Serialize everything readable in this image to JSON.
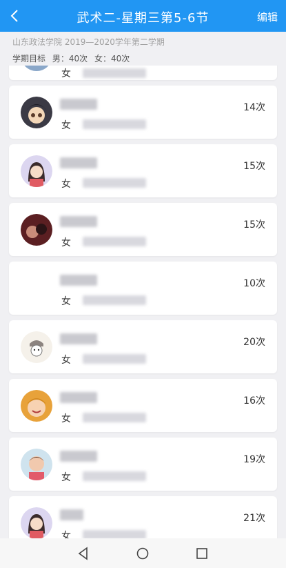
{
  "header": {
    "title": "武术二-星期三第5-6节",
    "edit_label": "编辑"
  },
  "subtitle": "山东政法学院 2019—2020学年第二学期",
  "targets": {
    "label": "学期目标",
    "male": "男：40次",
    "female": "女：40次"
  },
  "partial_item": {
    "gender": "女"
  },
  "students": [
    {
      "gender": "女",
      "count": "14次",
      "avatar": "anime-boy-avatar-icon"
    },
    {
      "gender": "女",
      "count": "15次",
      "avatar": "girl-cartoon-avatar-icon"
    },
    {
      "gender": "女",
      "count": "15次",
      "avatar": "dark-photo-avatar-icon"
    },
    {
      "gender": "女",
      "count": "10次",
      "avatar": "blank-avatar-icon"
    },
    {
      "gender": "女",
      "count": "20次",
      "avatar": "sketch-character-avatar-icon"
    },
    {
      "gender": "女",
      "count": "16次",
      "avatar": "cartoon-face-avatar-icon"
    },
    {
      "gender": "女",
      "count": "19次",
      "avatar": "baby-photo-avatar-icon"
    },
    {
      "gender": "女",
      "count": "21次",
      "avatar": "girl-cartoon-avatar-icon"
    }
  ],
  "colors": {
    "accent": "#2196f3",
    "background": "#f0f0f3"
  }
}
